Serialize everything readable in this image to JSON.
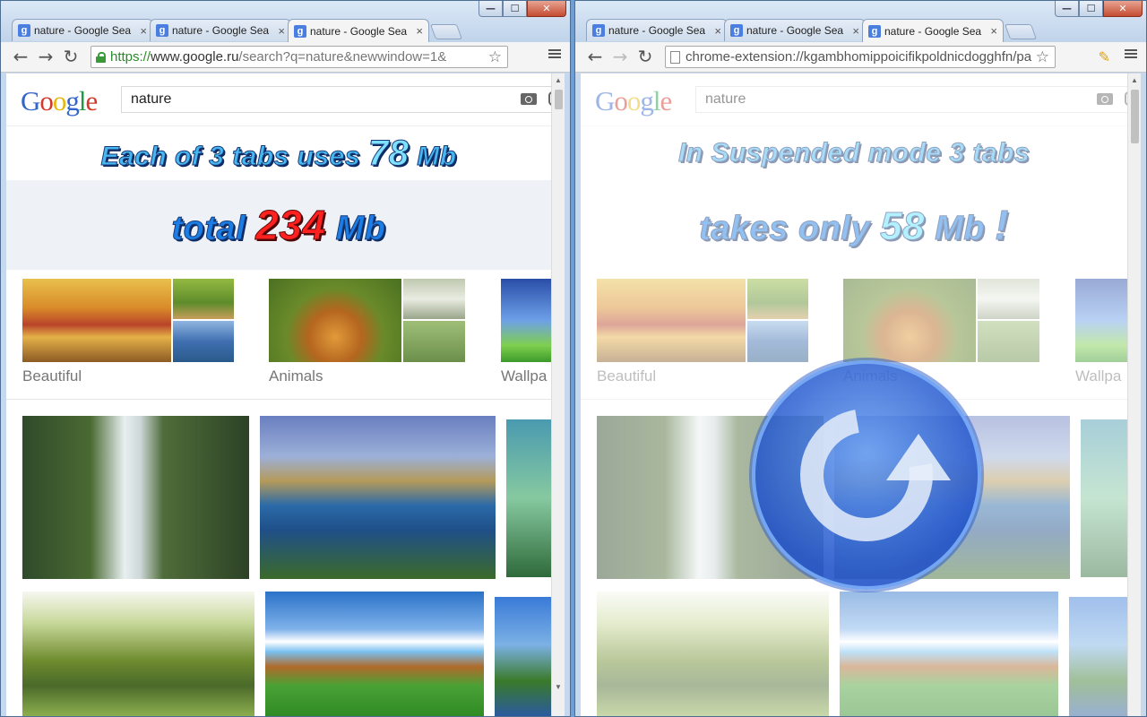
{
  "left_window": {
    "tabs": [
      {
        "title": "nature - Google Sea",
        "active": false
      },
      {
        "title": "nature - Google Sea",
        "active": false
      },
      {
        "title": "nature - Google Sea",
        "active": true
      }
    ],
    "url_scheme": "https://",
    "url_host": "www.google.ru",
    "url_rest": "/search?q=nature&newwindow=1&",
    "search_query": "nature",
    "banner_line1_prefix": "Each of 3 tabs uses",
    "banner_line1_num": "78",
    "banner_line1_unit": "Mb",
    "banner_line2_prefix": "total",
    "banner_line2_num": "234",
    "banner_line2_unit": "Mb",
    "categories": [
      "Beautiful",
      "Animals",
      "Wallpa"
    ]
  },
  "right_window": {
    "tabs": [
      {
        "title": "nature - Google Sea",
        "active": false
      },
      {
        "title": "nature - Google Sea",
        "active": false
      },
      {
        "title": "nature - Google Sea",
        "active": true
      }
    ],
    "url": "chrome-extension://kgambhomippoicifikpoldnicdogghfn/pa",
    "search_query": "nature",
    "banner_line1": "In Suspended mode 3 tabs",
    "banner_line2_prefix": "takes only",
    "banner_line2_num": "58",
    "banner_line2_unit": "Mb",
    "banner_line2_bang": "!",
    "categories": [
      "Beautiful",
      "Animals",
      "Wallpa"
    ]
  },
  "logo": {
    "letters": [
      "G",
      "o",
      "o",
      "g",
      "l",
      "e"
    ]
  },
  "window_controls": {
    "minimize": "—",
    "maximize": "☐",
    "close": "✕"
  },
  "icons": {
    "back": "back-arrow-icon",
    "forward": "forward-arrow-icon",
    "reload": "reload-icon",
    "star": "bookmark-star-icon",
    "menu": "hamburger-menu-icon",
    "extension": "broom-icon"
  },
  "glyphs": {
    "back": "←",
    "forward": "→",
    "reload": "↻",
    "star": "☆",
    "tab_close": "×",
    "tab_favicon": "g",
    "broom": "✎",
    "scroll_up": "▲",
    "scroll_down": "▼"
  },
  "colors": {
    "frame": "#c5d8ee",
    "promo_text": "#46b7f0",
    "promo_red": "#ff2020",
    "reload_overlay": "#2a6ad8"
  }
}
